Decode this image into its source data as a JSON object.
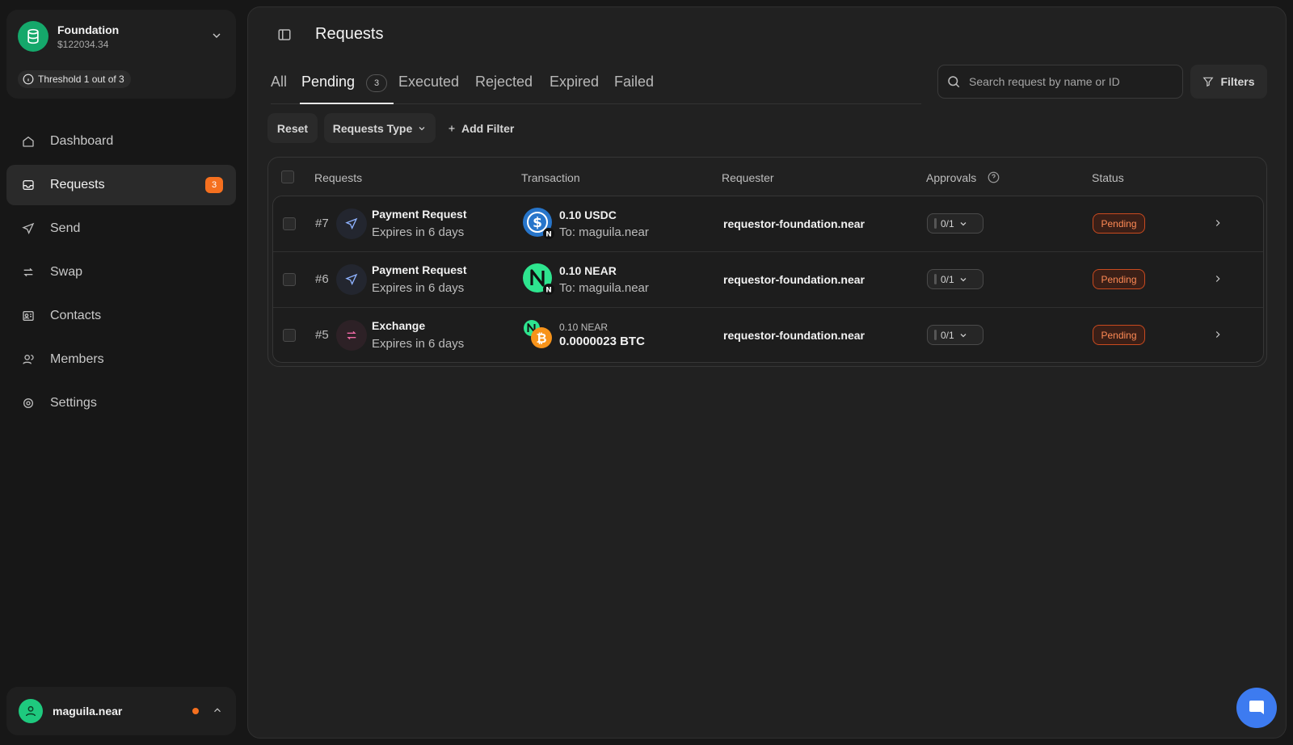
{
  "sidebar": {
    "org": {
      "name": "Foundation",
      "balance": "$122034.34",
      "threshold": "Threshold 1 out of 3"
    },
    "nav": [
      {
        "label": "Dashboard",
        "icon": "home-icon"
      },
      {
        "label": "Requests",
        "icon": "inbox-icon",
        "badge": "3",
        "active": true
      },
      {
        "label": "Send",
        "icon": "send-icon"
      },
      {
        "label": "Swap",
        "icon": "swap-icon"
      },
      {
        "label": "Contacts",
        "icon": "contacts-icon"
      },
      {
        "label": "Members",
        "icon": "members-icon"
      },
      {
        "label": "Settings",
        "icon": "settings-icon"
      }
    ],
    "user": {
      "name": "maguila.near"
    }
  },
  "header": {
    "title": "Requests"
  },
  "tabs": [
    {
      "label": "All"
    },
    {
      "label": "Pending",
      "count": "3",
      "active": true
    },
    {
      "label": "Executed"
    },
    {
      "label": "Rejected"
    },
    {
      "label": "Expired"
    },
    {
      "label": "Failed"
    }
  ],
  "search": {
    "placeholder": "Search request by name or ID"
  },
  "filters": {
    "button_label": "Filters",
    "reset_label": "Reset",
    "type_label": "Requests Type",
    "add_label": "Add Filter"
  },
  "table": {
    "columns": [
      "Requests",
      "Transaction",
      "Requester",
      "Approvals",
      "Status"
    ],
    "rows": [
      {
        "id": "#7",
        "title": "Payment Request",
        "sub": "Expires in 6 days",
        "amount": "0.10 USDC",
        "to": "To: maguila.near",
        "requester": "requestor-foundation.near",
        "approvals": "0/1",
        "status": "Pending"
      },
      {
        "id": "#6",
        "title": "Payment Request",
        "sub": "Expires in 6 days",
        "amount": "0.10 NEAR",
        "to": "To: maguila.near",
        "requester": "requestor-foundation.near",
        "approvals": "0/1",
        "status": "Pending"
      },
      {
        "id": "#5",
        "title": "Exchange",
        "sub": "Expires in 6 days",
        "from_amount": "0.10 NEAR",
        "to_amount": "0.0000023 BTC",
        "requester": "requestor-foundation.near",
        "approvals": "0/1",
        "status": "Pending"
      }
    ]
  },
  "colors": {
    "accent_orange": "#f5701f",
    "org_green": "#15a86b",
    "chat_blue": "#3d7bf0",
    "status_pending": "#ff8a55"
  }
}
